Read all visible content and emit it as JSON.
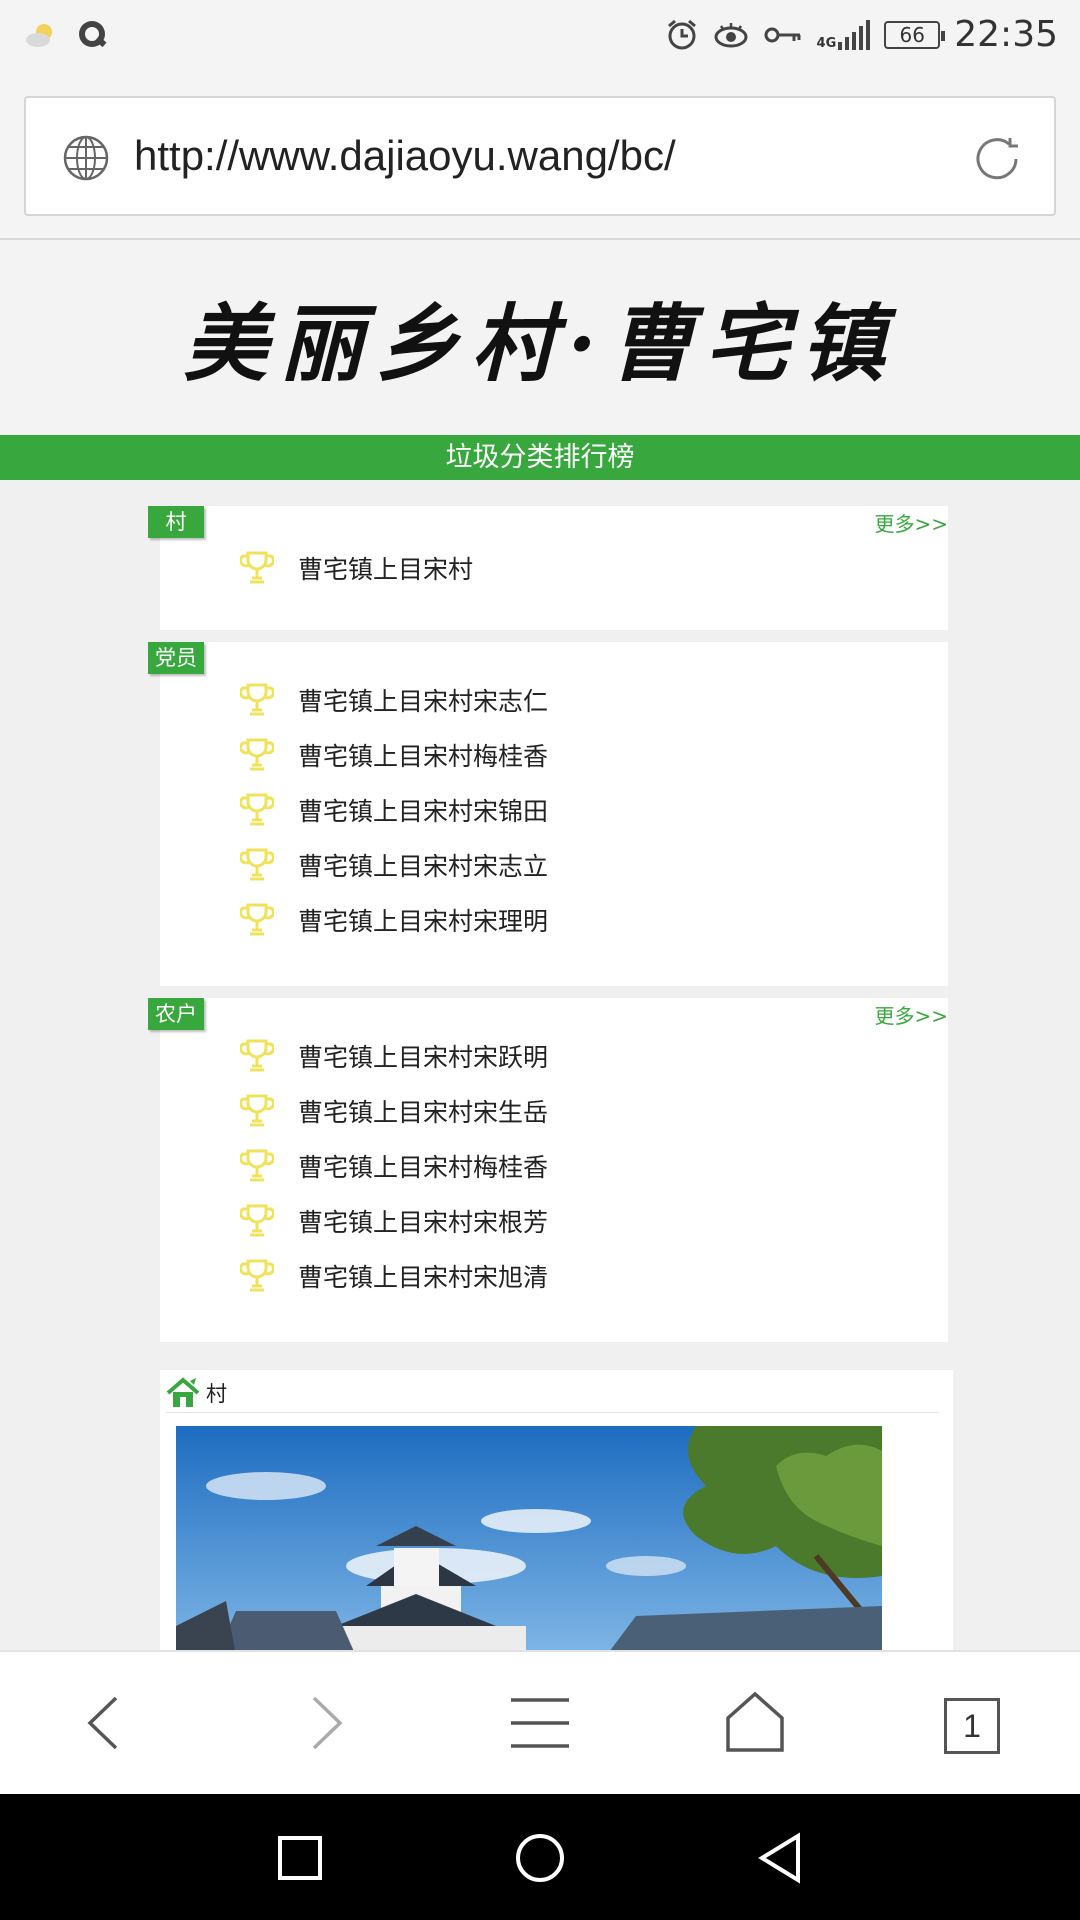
{
  "status_bar": {
    "time": "22:35",
    "battery": "66",
    "network": "4G",
    "icons": [
      "weather-icon",
      "q-app-icon",
      "alarm-icon",
      "eye-icon",
      "key-icon",
      "signal-icon",
      "battery-icon"
    ]
  },
  "address_bar": {
    "url": "http://www.dajiaoyu.wang/bc/",
    "icons": [
      "globe-icon",
      "refresh-icon"
    ]
  },
  "page": {
    "banner_title": "美丽乡村·曹宅镇",
    "section_title": "垃圾分类排行榜",
    "more_label": "更多>>",
    "rankings": [
      {
        "tag": "村",
        "has_more": true,
        "items": [
          "曹宅镇上目宋村"
        ]
      },
      {
        "tag": "党员",
        "has_more": false,
        "items": [
          "曹宅镇上目宋村宋志仁",
          "曹宅镇上目宋村梅桂香",
          "曹宅镇上目宋村宋锦田",
          "曹宅镇上目宋村宋志立",
          "曹宅镇上目宋村宋理明"
        ]
      },
      {
        "tag": "农户",
        "has_more": true,
        "items": [
          "曹宅镇上目宋村宋跃明",
          "曹宅镇上目宋村宋生岳",
          "曹宅镇上目宋村梅桂香",
          "曹宅镇上目宋村宋根芳",
          "曹宅镇上目宋村宋旭清"
        ]
      }
    ],
    "village_section": {
      "title": "村"
    }
  },
  "browser_toolbar": {
    "tab_count": "1",
    "buttons": [
      "back-icon",
      "forward-icon",
      "menu-icon",
      "home-icon",
      "tabs-icon"
    ]
  },
  "colors": {
    "accent_green": "#38a83e",
    "trophy_yellow": "#f2e45a"
  }
}
